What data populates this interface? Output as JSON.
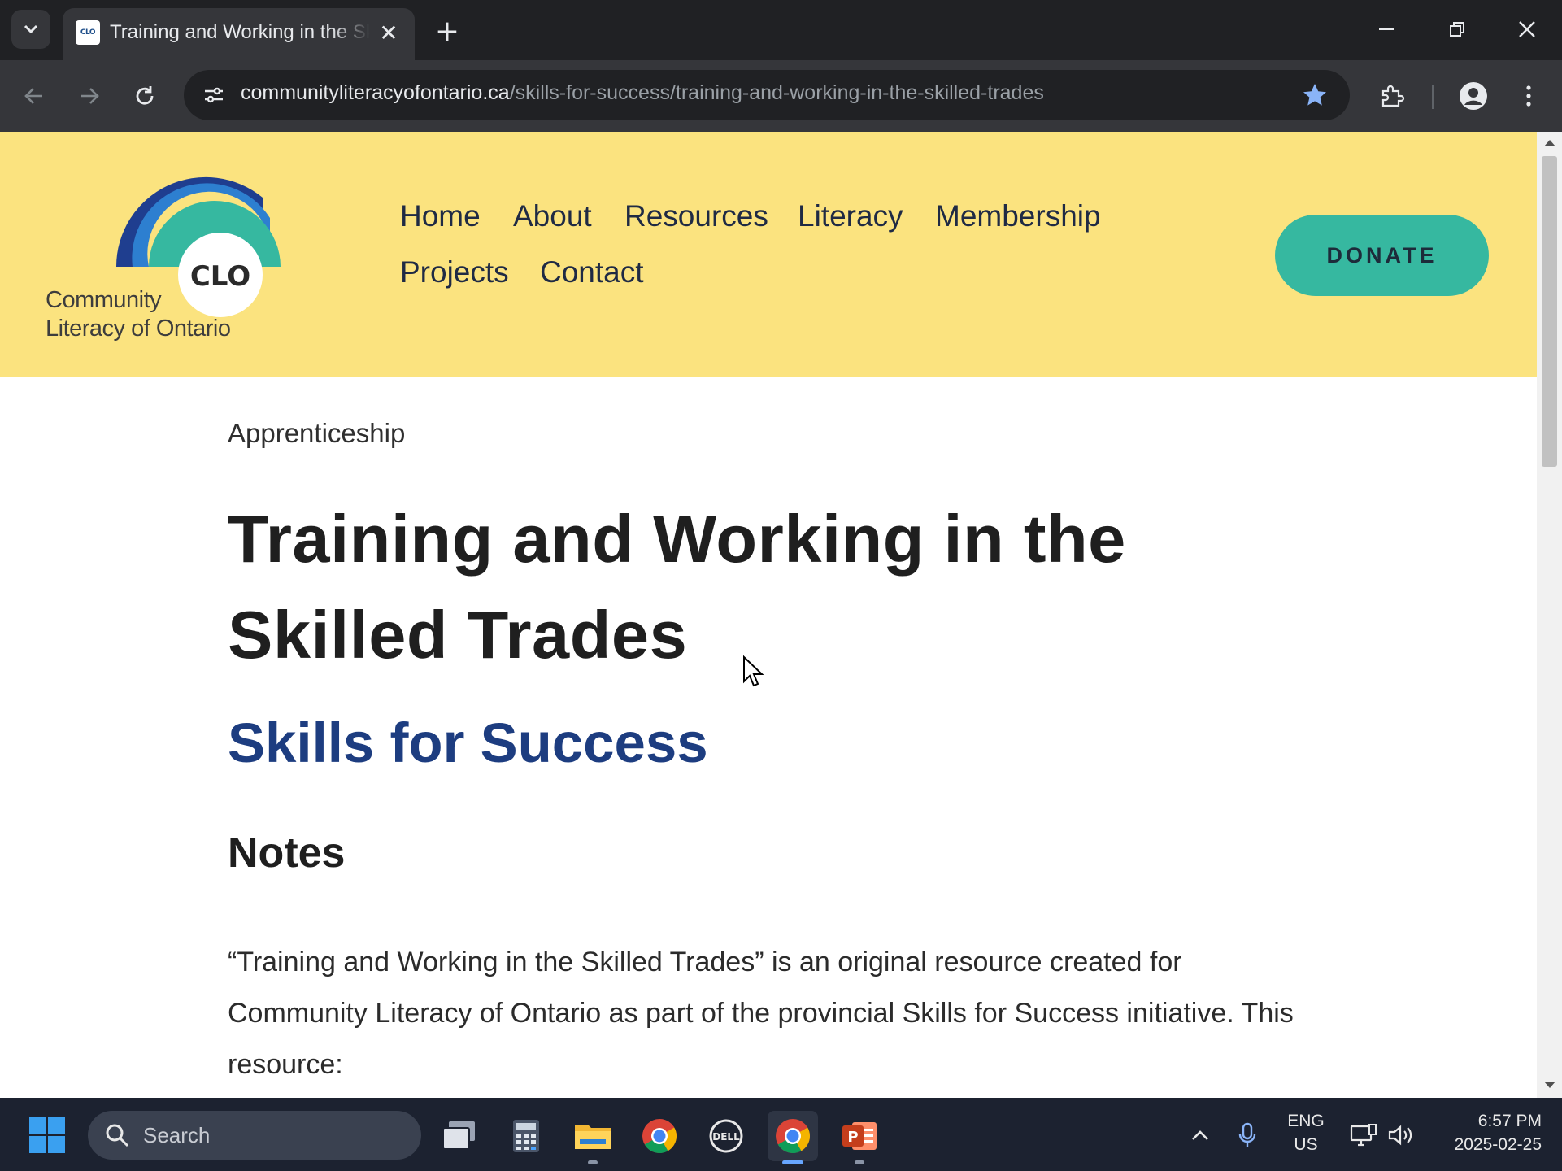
{
  "browser": {
    "tab_title": "Training and Working in the Skilled Trades",
    "tab_favicon_text": "CLO",
    "close_tab_glyph": "✕",
    "new_tab_glyph": "+",
    "url_host": "communityliteracyofontario.ca",
    "url_path": "/skills-for-success/training-and-working-in-the-skilled-trades",
    "bookmarked": true,
    "accent_color": "#8ab4f8"
  },
  "site": {
    "logo_badge": "CLO",
    "logo_line1": "Community",
    "logo_line2": "Literacy of Ontario",
    "nav": [
      "Home",
      "About",
      "Resources",
      "Literacy",
      "Membership",
      "Projects",
      "Contact"
    ],
    "donate_label": "DONATE",
    "header_color": "#fbe37f",
    "donate_color": "#36b8a0"
  },
  "page": {
    "eyebrow": "Apprenticeship",
    "title": "Training and Working in the Skilled Trades",
    "subtitle": "Skills for Success",
    "notes_heading": "Notes",
    "body": "“Training and Working in the Skilled Trades” is an original resource created for Community Literacy of Ontario as part of the provincial Skills for Success initiative. This resource:",
    "subtitle_color": "#1d3d80"
  },
  "taskbar": {
    "search_label": "Search",
    "apps": [
      "task-view-icon",
      "calculator-icon",
      "file-explorer-icon",
      "chrome-icon",
      "dell-icon",
      "chrome-icon",
      "powerpoint-icon"
    ],
    "lang_line1": "ENG",
    "lang_line2": "US",
    "time": "6:57 PM",
    "date": "2025-02-25"
  }
}
